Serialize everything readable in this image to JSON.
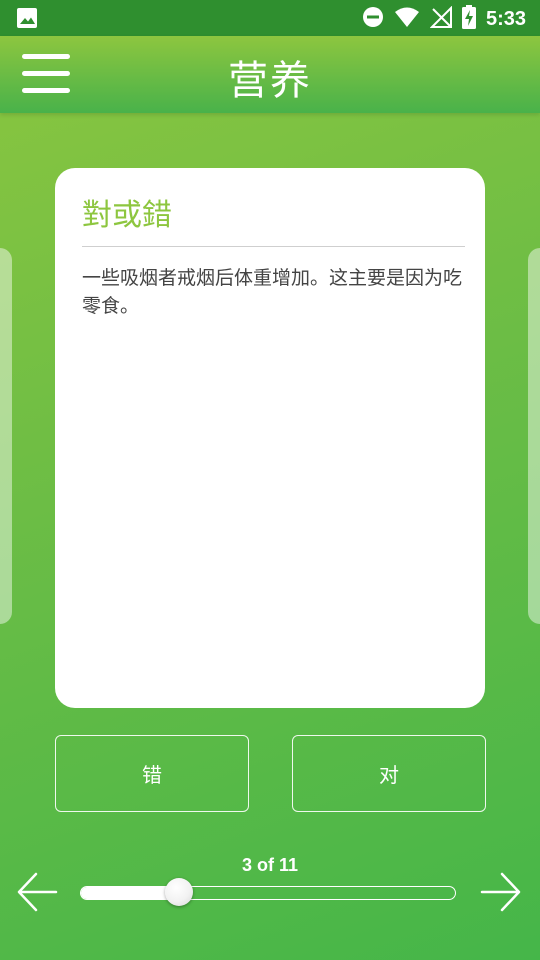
{
  "status_bar": {
    "time": "5:33",
    "icons": [
      "image-icon",
      "do-not-disturb-icon",
      "wifi-icon",
      "no-signal-icon",
      "battery-charging-icon"
    ]
  },
  "app_bar": {
    "title": "营养",
    "menu_icon": "hamburger-menu-icon"
  },
  "card": {
    "title": "對或錯",
    "statement": "一些吸烟者戒烟后体重增加。这主要是因为吃零食。"
  },
  "answers": {
    "false_label": "错",
    "true_label": "对"
  },
  "progress": {
    "label": "3 of 11",
    "current": 3,
    "total": 11
  },
  "navigation": {
    "prev_icon": "arrow-left-icon",
    "next_icon": "arrow-right-icon"
  },
  "colors": {
    "accent_green": "#8dc63f",
    "gradient_end": "#45b649",
    "statusbar": "#2f8f2f"
  }
}
